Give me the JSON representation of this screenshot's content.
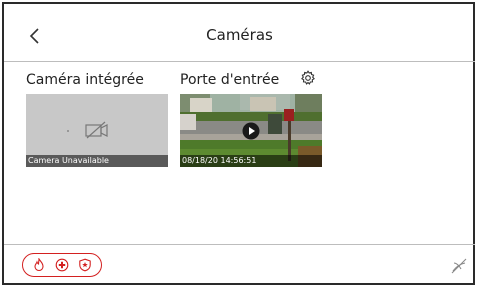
{
  "header": {
    "title": "Caméras"
  },
  "cameras": [
    {
      "name": "Caméra intégrée",
      "caption": "Camera Unavailable",
      "status": "unavailable"
    },
    {
      "name": "Porte d'entrée",
      "caption": "08/18/20 14:56:51",
      "status": "live"
    }
  ],
  "footer": {
    "emergency_icons": [
      "fire-icon",
      "medical-cross-icon",
      "police-badge-icon"
    ],
    "status_icon": "no-connection-icon"
  },
  "colors": {
    "emergency": "#d32020",
    "text": "#222222",
    "divider": "#bdbdbd"
  }
}
